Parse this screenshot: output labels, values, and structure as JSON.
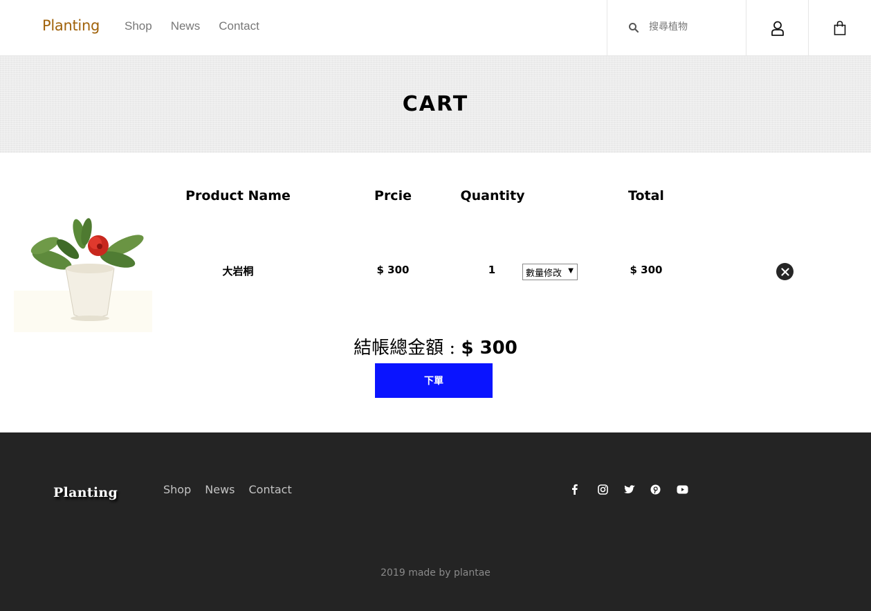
{
  "header": {
    "logo": "Planting",
    "nav": [
      "Shop",
      "News",
      "Contact"
    ],
    "search_placeholder": "搜尋植物"
  },
  "banner": {
    "title": "CART"
  },
  "cart": {
    "columns": [
      "Product Name",
      "Prcie",
      "Quantity",
      "Total"
    ],
    "items": [
      {
        "name": "大岩桐",
        "price": "$ 300",
        "quantity": "1",
        "quantity_select": "數量修改",
        "total": "$ 300"
      }
    ],
    "checkout_label": "結帳總金額 : ",
    "checkout_total": "$ 300",
    "order_button": "下單"
  },
  "footer": {
    "logo": "Planting",
    "nav": [
      "Shop",
      "News",
      "Contact"
    ],
    "social_icons": [
      "facebook-icon",
      "instagram-icon",
      "twitter-icon",
      "pinterest-icon",
      "youtube-icon"
    ],
    "copyright": "2019 made by plantae"
  },
  "colors": {
    "logo": "#a0620a",
    "order_button": "#0a14ff",
    "footer_bg": "#242424"
  }
}
